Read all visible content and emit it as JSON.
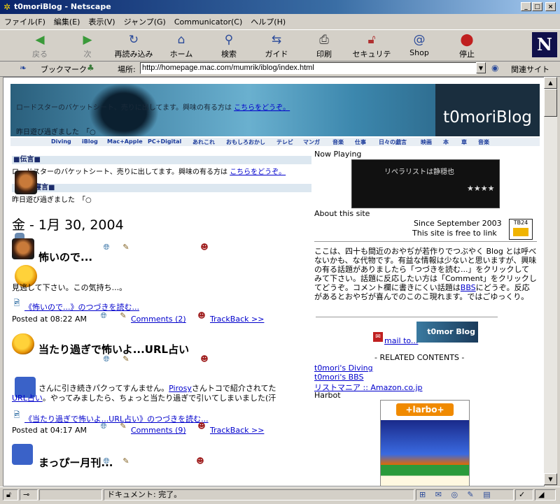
{
  "window": {
    "title": "t0moriBlog - Netscape",
    "buttons": {
      "minimize": "_",
      "maximize": "□",
      "close": "×"
    }
  },
  "menu": [
    "ファイル(F)",
    "編集(E)",
    "表示(V)",
    "ジャンプ(G)",
    "Communicator(C)",
    "ヘルプ(H)"
  ],
  "toolbar": {
    "back": "戻る",
    "forward": "次",
    "reload": "再読み込み",
    "home": "ホーム",
    "search": "検索",
    "guide": "ガイド",
    "print": "印刷",
    "security": "セキュリティ",
    "shop": "Shop",
    "stop": "停止",
    "logo": "N"
  },
  "location": {
    "bookmarks": "ブックマーク",
    "label": "場所:",
    "url": "http://homepage.mac.com/mumrik/iblog/index.html",
    "related": "関連サイト"
  },
  "banner": {
    "line1": "ロードスターのバケットシート、売りに出してます。興味の有る方は",
    "line1_link": "こちらをどうぞ。",
    "line2": "昨日遊び過ぎました　「○",
    "brand": "t0moriBlog"
  },
  "nav": [
    "Diving",
    "iBlog",
    "Mac+Apple",
    "PC+Digital",
    "あれこれ",
    "おもしろおかし",
    "テレビ",
    "マンガ",
    "音楽",
    "仕事",
    "日々の戯言",
    "映画",
    "本",
    "車",
    "音楽"
  ],
  "notices": {
    "head1": "■伝言■",
    "text1": "ロードスターのバケットシート、売りに出してます。興味の有る方は",
    "link1": "こちらをどうぞ。",
    "head2": "■独り言■",
    "head2_visible": "寝言■",
    "text2": "昨日遊び過ぎました　「○"
  },
  "date": "金 - 1月 30, 2004",
  "posts": [
    {
      "title": "怖いので...",
      "body": "見逃して下さい。この気持ち...。",
      "more": "《怖いので...》のつづきを読む...",
      "posted": "Posted at 08:22 AM",
      "comments": "Comments (2)",
      "trackback": "TrackBack >>"
    },
    {
      "title": "当たり過ぎで怖いよ...URL占い",
      "body1": "さんに引き続きパクってすんません。",
      "body1_link": "Pirosy",
      "body1_tail": "さんトコで紹介されてた",
      "body2_link": "URL占い",
      "body2": "。やってみましたら、ちょっと当たり過ぎで引いてしまいました(汗",
      "more": "《当たり過ぎで怖いよ...URL占い》のつづきを読む...",
      "posted": "Posted at 04:17 AM",
      "comments": "Comments (9)",
      "trackback": "TrackBack >>"
    },
    {
      "title": "まっぴー月刊..."
    }
  ],
  "sidebar": {
    "now_playing": "Now Playing",
    "player_text": "リペラリストは静穏也",
    "player_stars": "★★★★",
    "about": "About this site",
    "since": "Since September 2003",
    "free_link": "This site is free to link",
    "badge": "TB24",
    "desc1": "ここは、四十も間近のおやぢが若作りでつぶやく Blog とは呼べないかも、な代物です。有益な情報は少ないと思いますが、興味の有る話題がありましたら「つづきを読む...」をクリックしてみて下さい。話題に反応したい方は「Comment」をクリックしてどうぞ。コメント欄に書きにくい話題は",
    "desc_link": "BBS",
    "desc2": "にどうぞ。反応があるとおやぢが喜んでのこのこ現れます。ではごゆっくり。",
    "mail": "mail to...",
    "mail_brand": "t0mor Blog",
    "related_head": "- RELATED CONTENTS -",
    "related": [
      "t0mori's Diving",
      "t0mori's BBS",
      "リストマニア :: Amazon.co.jp"
    ],
    "harbot": "Harbot",
    "harbot_logo": "+larbo+"
  },
  "status": {
    "text": "ドキュメント: 完了。"
  },
  "colors": {
    "titlebar": "#0a246a",
    "link": "#0000cc",
    "chrome": "#d4d0c8"
  }
}
